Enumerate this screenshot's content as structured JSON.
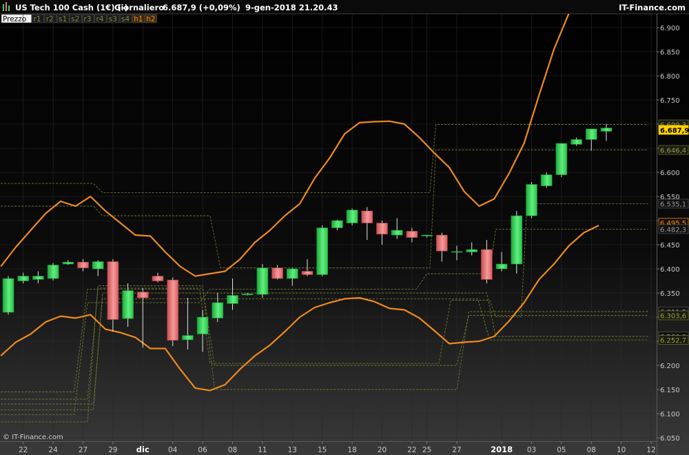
{
  "header": {
    "instrument": "US Tech 100 Cash (1€) (-)",
    "period": "Giornaliero",
    "last": "6.687,9 (+0,09%)",
    "datetime": "9-gen-2018 21.20.43",
    "brand": "IT-Finance.com"
  },
  "legend_tabs": [
    {
      "label": "Prezzo",
      "active": true
    },
    {
      "label": "r1",
      "active": false
    },
    {
      "label": "r2",
      "active": false
    },
    {
      "label": "s1",
      "active": false
    },
    {
      "label": "s2",
      "active": false
    },
    {
      "label": "r3",
      "active": false
    },
    {
      "label": "r4",
      "active": false
    },
    {
      "label": "s3",
      "active": false
    },
    {
      "label": "s4",
      "active": false
    },
    {
      "label": "h1",
      "active": true
    },
    {
      "label": "h2",
      "active": true
    }
  ],
  "copyright": "© IT-Finance.com",
  "colors": {
    "up": "#3ed35f",
    "down": "#e8797b",
    "band": "#f08a1c",
    "pivot": "#6e7a32",
    "grid": "#2a2a2a",
    "axis_text": "#c8c8c8"
  },
  "chart_data": {
    "type": "candlestick",
    "ylim": [
      6050,
      6930
    ],
    "y_ticks": [
      6050,
      6100,
      6150,
      6200,
      6250,
      6300,
      6350,
      6400,
      6450,
      6500,
      6550,
      6600,
      6650,
      6700,
      6750,
      6800,
      6850,
      6900
    ],
    "y_tick_labels": [
      "6.050",
      "6.100",
      "6.150",
      "6.200",
      "6.250",
      "6.300",
      "6.350",
      "6.400",
      "6.450",
      "6.500",
      "6.550",
      "6.600",
      "6.650",
      "6.700",
      "6.750",
      "6.800",
      "6.850",
      "6.900"
    ],
    "x_ticks": [
      {
        "i": 1,
        "label": "22",
        "bold": false
      },
      {
        "i": 3,
        "label": "24",
        "bold": false
      },
      {
        "i": 5,
        "label": "27",
        "bold": false
      },
      {
        "i": 7,
        "label": "29",
        "bold": false
      },
      {
        "i": 9,
        "label": "dic",
        "bold": true
      },
      {
        "i": 11,
        "label": "04",
        "bold": false
      },
      {
        "i": 13,
        "label": "06",
        "bold": false
      },
      {
        "i": 15,
        "label": "08",
        "bold": false
      },
      {
        "i": 17,
        "label": "11",
        "bold": false
      },
      {
        "i": 19,
        "label": "13",
        "bold": false
      },
      {
        "i": 21,
        "label": "15",
        "bold": false
      },
      {
        "i": 23,
        "label": "18",
        "bold": false
      },
      {
        "i": 25,
        "label": "20",
        "bold": false
      },
      {
        "i": 27,
        "label": "22",
        "bold": false
      },
      {
        "i": 28,
        "label": "25",
        "bold": false
      },
      {
        "i": 30,
        "label": "27",
        "bold": false
      },
      {
        "i": 33,
        "label": "2018",
        "bold": true
      },
      {
        "i": 35,
        "label": "03",
        "bold": false
      },
      {
        "i": 37,
        "label": "05",
        "bold": false
      },
      {
        "i": 39,
        "label": "08",
        "bold": false
      },
      {
        "i": 41,
        "label": "10",
        "bold": false
      },
      {
        "i": 43,
        "label": "12",
        "bold": false
      }
    ],
    "candles": [
      {
        "o": 6310,
        "h": 6385,
        "l": 6305,
        "c": 6380
      },
      {
        "o": 6375,
        "h": 6392,
        "l": 6370,
        "c": 6385
      },
      {
        "o": 6378,
        "h": 6395,
        "l": 6370,
        "c": 6385
      },
      {
        "o": 6380,
        "h": 6412,
        "l": 6376,
        "c": 6408
      },
      {
        "o": 6410,
        "h": 6418,
        "l": 6408,
        "c": 6414
      },
      {
        "o": 6414,
        "h": 6420,
        "l": 6395,
        "c": 6402
      },
      {
        "o": 6400,
        "h": 6418,
        "l": 6385,
        "c": 6415
      },
      {
        "o": 6415,
        "h": 6420,
        "l": 6270,
        "c": 6295
      },
      {
        "o": 6297,
        "h": 6370,
        "l": 6280,
        "c": 6355
      },
      {
        "o": 6352,
        "h": 6360,
        "l": 6237,
        "c": 6340
      },
      {
        "o": 6385,
        "h": 6392,
        "l": 6372,
        "c": 6375
      },
      {
        "o": 6377,
        "h": 6382,
        "l": 6240,
        "c": 6252
      },
      {
        "o": 6253,
        "h": 6340,
        "l": 6233,
        "c": 6262
      },
      {
        "o": 6265,
        "h": 6315,
        "l": 6228,
        "c": 6300
      },
      {
        "o": 6298,
        "h": 6350,
        "l": 6290,
        "c": 6330
      },
      {
        "o": 6328,
        "h": 6380,
        "l": 6315,
        "c": 6345
      },
      {
        "o": 6346,
        "h": 6350,
        "l": 6345,
        "c": 6348
      },
      {
        "o": 6347,
        "h": 6410,
        "l": 6340,
        "c": 6402
      },
      {
        "o": 6402,
        "h": 6408,
        "l": 6378,
        "c": 6380
      },
      {
        "o": 6380,
        "h": 6402,
        "l": 6365,
        "c": 6400
      },
      {
        "o": 6395,
        "h": 6420,
        "l": 6385,
        "c": 6388
      },
      {
        "o": 6388,
        "h": 6490,
        "l": 6385,
        "c": 6485
      },
      {
        "o": 6485,
        "h": 6502,
        "l": 6480,
        "c": 6500
      },
      {
        "o": 6495,
        "h": 6525,
        "l": 6490,
        "c": 6522
      },
      {
        "o": 6520,
        "h": 6528,
        "l": 6460,
        "c": 6495
      },
      {
        "o": 6495,
        "h": 6500,
        "l": 6450,
        "c": 6472
      },
      {
        "o": 6470,
        "h": 6505,
        "l": 6462,
        "c": 6480
      },
      {
        "o": 6478,
        "h": 6485,
        "l": 6455,
        "c": 6465
      },
      {
        "o": 6468,
        "h": 6470,
        "l": 6465,
        "c": 6470
      },
      {
        "o": 6470,
        "h": 6475,
        "l": 6415,
        "c": 6437
      },
      {
        "o": 6436,
        "h": 6448,
        "l": 6418,
        "c": 6436
      },
      {
        "o": 6435,
        "h": 6455,
        "l": 6428,
        "c": 6440
      },
      {
        "o": 6440,
        "h": 6460,
        "l": 6370,
        "c": 6378
      },
      {
        "o": 6400,
        "h": 6435,
        "l": 6395,
        "c": 6410
      },
      {
        "o": 6410,
        "h": 6520,
        "l": 6390,
        "c": 6510
      },
      {
        "o": 6510,
        "h": 6580,
        "l": 6505,
        "c": 6575
      },
      {
        "o": 6572,
        "h": 6600,
        "l": 6568,
        "c": 6595
      },
      {
        "o": 6595,
        "h": 6660,
        "l": 6590,
        "c": 6660
      },
      {
        "o": 6658,
        "h": 6672,
        "l": 6655,
        "c": 6668
      },
      {
        "o": 6668,
        "h": 6690,
        "l": 6645,
        "c": 6690
      },
      {
        "o": 6685,
        "h": 6700,
        "l": 6665,
        "c": 6692
      }
    ],
    "bollinger_upper": [
      6405,
      6445,
      6480,
      6515,
      6540,
      6530,
      6550,
      6520,
      6495,
      6470,
      6468,
      6435,
      6405,
      6385,
      6390,
      6395,
      6420,
      6455,
      6480,
      6510,
      6535,
      6588,
      6630,
      6680,
      6703,
      6705,
      6706,
      6700,
      6672,
      6640,
      6610,
      6560,
      6530,
      6545,
      6598,
      6660,
      6760,
      6855,
      6930
    ],
    "bollinger_lower": [
      6220,
      6248,
      6265,
      6290,
      6302,
      6298,
      6305,
      6275,
      6268,
      6258,
      6235,
      6235,
      6192,
      6153,
      6148,
      6160,
      6192,
      6220,
      6242,
      6270,
      6300,
      6320,
      6330,
      6338,
      6340,
      6332,
      6318,
      6315,
      6298,
      6272,
      6245,
      6248,
      6250,
      6260,
      6292,
      6330,
      6378,
      6410,
      6448,
      6475,
      6490
    ],
    "pivot_lines": [
      {
        "points": [
          [
            -0.5,
            6577
          ],
          [
            5.7,
            6577
          ],
          [
            6.3,
            6558
          ],
          [
            28.2,
            6558
          ],
          [
            28.6,
            6699.3
          ],
          [
            42.8,
            6699.3
          ]
        ]
      },
      {
        "points": [
          [
            -0.5,
            6530
          ],
          [
            5.7,
            6530
          ],
          [
            6.3,
            6510
          ],
          [
            13.5,
            6510
          ],
          [
            14.2,
            6402
          ],
          [
            28.2,
            6402
          ],
          [
            28.6,
            6646.4
          ],
          [
            42.8,
            6646.4
          ]
        ]
      },
      {
        "points": [
          [
            -0.5,
            6145
          ],
          [
            4.4,
            6145
          ],
          [
            5.3,
            6358
          ],
          [
            12.8,
            6358
          ],
          [
            13.5,
            6204
          ],
          [
            28.8,
            6204
          ],
          [
            29.6,
            6335
          ],
          [
            32.2,
            6335
          ],
          [
            32.6,
            6301
          ],
          [
            34.3,
            6301
          ],
          [
            34.7,
            6535.1
          ],
          [
            42.8,
            6535.1
          ]
        ]
      },
      {
        "points": [
          [
            -0.5,
            6098
          ],
          [
            4.4,
            6098
          ],
          [
            5.3,
            6330
          ],
          [
            12.8,
            6330
          ],
          [
            13.5,
            6358
          ],
          [
            27.3,
            6358
          ],
          [
            28.0,
            6390
          ],
          [
            32.2,
            6390
          ],
          [
            32.6,
            6482.3
          ],
          [
            42.8,
            6482.3
          ]
        ]
      },
      {
        "points": [
          [
            -0.5,
            6083
          ],
          [
            5.3,
            6083
          ],
          [
            6.0,
            6365
          ],
          [
            13.0,
            6365
          ],
          [
            13.8,
            6150
          ],
          [
            30.0,
            6150
          ],
          [
            30.8,
            6311.5
          ],
          [
            42.8,
            6311.5
          ]
        ]
      },
      {
        "points": [
          [
            -0.5,
            6130
          ],
          [
            5.3,
            6130
          ],
          [
            6.0,
            6360
          ],
          [
            13.0,
            6360
          ],
          [
            13.8,
            6200
          ],
          [
            30.0,
            6200
          ],
          [
            30.8,
            6303.6
          ],
          [
            42.8,
            6303.6
          ]
        ]
      },
      {
        "points": [
          [
            -0.5,
            6108
          ],
          [
            5.7,
            6108
          ],
          [
            6.3,
            6350
          ],
          [
            32.0,
            6350
          ],
          [
            32.6,
            6260.0
          ],
          [
            42.8,
            6260.0
          ]
        ]
      },
      {
        "points": [
          [
            -0.5,
            6120
          ],
          [
            5.7,
            6120
          ],
          [
            6.3,
            6338
          ],
          [
            31.4,
            6338
          ],
          [
            32.2,
            6252.7
          ],
          [
            42.8,
            6252.7
          ]
        ]
      }
    ],
    "right_labels": [
      {
        "value": 6699.3,
        "label": "6.699,3",
        "style": "pivot"
      },
      {
        "value": 6687.9,
        "label": "6.687,9",
        "style": "last"
      },
      {
        "value": 6646.4,
        "label": "6.646,4",
        "style": "pivot"
      },
      {
        "value": 6535.1,
        "label": "6.535,1",
        "style": "gray"
      },
      {
        "value": 6495.5,
        "label": "6.495,5",
        "style": "band"
      },
      {
        "value": 6482.3,
        "label": "6.482,3",
        "style": "gray"
      },
      {
        "value": 6311.5,
        "label": "6.311,5",
        "style": "gray"
      },
      {
        "value": 6303.6,
        "label": "6.303,6",
        "style": "pivot"
      },
      {
        "value": 6260.0,
        "label": "6.260,0",
        "style": "gray"
      },
      {
        "value": 6252.7,
        "label": "6.252,7",
        "style": "pivot"
      }
    ]
  }
}
